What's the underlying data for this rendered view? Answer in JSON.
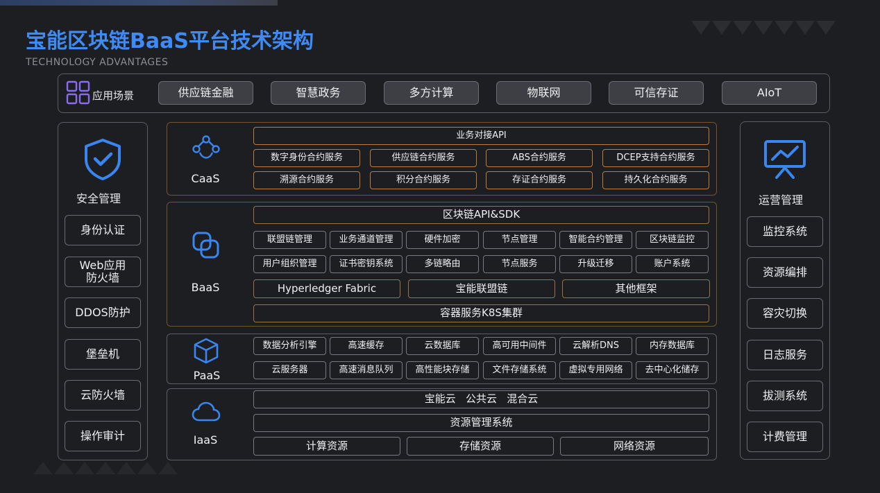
{
  "header": {
    "title": "宝能区块链BaaS平台技术架构",
    "subtitle": "TECHNOLOGY ADVANTAGES"
  },
  "scenarios": {
    "label": "应用场景",
    "items": [
      "供应链金融",
      "智慧政务",
      "多方计算",
      "物联网",
      "可信存证",
      "AIoT"
    ]
  },
  "security": {
    "title": "安全管理",
    "items": [
      "身份认证",
      "Web应用\n防火墙",
      "DDOS防护",
      "堡垒机",
      "云防火墙",
      "操作审计"
    ]
  },
  "operations": {
    "title": "运营管理",
    "items": [
      "监控系统",
      "资源编排",
      "容灾切换",
      "日志服务",
      "拔测系统",
      "计费管理"
    ]
  },
  "caas": {
    "label": "CaaS",
    "api": "业务对接API",
    "row1": [
      "数字身份合约服务",
      "供应链合约服务",
      "ABS合约服务",
      "DCEP支持合约服务"
    ],
    "row2": [
      "溯源合约服务",
      "积分合约服务",
      "存证合约服务",
      "持久化合约服务"
    ]
  },
  "baas": {
    "label": "BaaS",
    "sdk": "区块链API&SDK",
    "row1": [
      "联盟链管理",
      "业务通道管理",
      "硬件加密",
      "节点管理",
      "智能合约管理",
      "区块链监控"
    ],
    "row2": [
      "用户组织管理",
      "证书密钥系统",
      "多链略由",
      "节点服务",
      "升级迁移",
      "账户系统"
    ],
    "frameworks": [
      "Hyperledger Fabric",
      "宝能联盟链",
      "其他框架"
    ],
    "k8s": "容器服务K8S集群"
  },
  "paas": {
    "label": "PaaS",
    "row1": [
      "数据分析引擎",
      "高速缓存",
      "云数据库",
      "高可用中间件",
      "云解析DNS",
      "内存数据库"
    ],
    "row2": [
      "云服务器",
      "高速消息队列",
      "高性能块存储",
      "文件存储系统",
      "虚拟专用网络",
      "去中心化储存"
    ]
  },
  "iaas": {
    "label": "IaaS",
    "clouds": "宝能云   公共云   混合云",
    "resource_mgmt": "资源管理系统",
    "resources": [
      "计算资源",
      "存储资源",
      "网络资源"
    ]
  },
  "colors": {
    "title_blue": "#3e8bf5",
    "icon_blue": "#3a86f0",
    "icon_purple": "#8a6cf0",
    "orange_border": "#c07b3a"
  },
  "icons": {
    "scenarios": "grid-icon",
    "security": "shield-check-icon",
    "operations": "presentation-chart-icon",
    "caas": "share-nodes-icon",
    "baas": "overlap-squares-icon",
    "paas": "cube-icon",
    "iaas": "cloud-icon"
  }
}
